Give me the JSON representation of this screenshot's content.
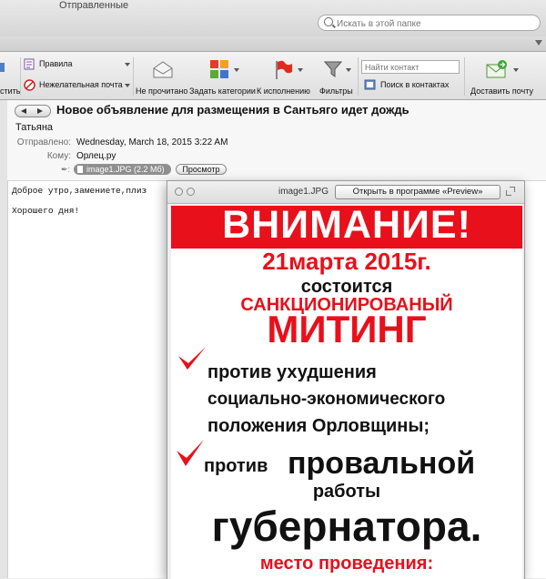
{
  "window": {
    "folder_title": "Отправленные",
    "search_placeholder": "Искать в этой папке"
  },
  "toolbar": {
    "clipped_label": "стить",
    "rules": "Правила",
    "junk": "Нежелательная почта",
    "unread": "Не прочитано",
    "categories": "Задать категории",
    "followup": "К исполнению",
    "filters": "Фильтры",
    "find_contact_placeholder": "Найти контакт",
    "search_contacts": "Поиск в контактах",
    "send_receive": "Доставить почту"
  },
  "message": {
    "subject": "Новое объявление для размещения в Сантьяго идет дождь",
    "sender": "Татьяна",
    "sent_label": "Отправлено:",
    "sent_value": "Wednesday, March 18, 2015 3:22 AM",
    "to_label": "Кому:",
    "to_value": "Орлец.ру",
    "attachment": "image1.JPG (2.2 Мб)",
    "preview_button": "Просмотр",
    "body_line1": "Доброе утро,замениете,плиз",
    "body_line2": "Хорошего дня!"
  },
  "quicklook": {
    "filename": "image1.JPG",
    "open_button": "Открыть в программе «Preview»"
  },
  "poster": {
    "banner": "ВНИМАНИЕ!",
    "date": "21марта 2015г.",
    "l1": "состоится",
    "l2": "САНКЦИОНИРОВАНЫЙ",
    "l3": "МИТИНГ",
    "l4": "против ухудшения",
    "l5": "социально-экономического",
    "l6": "положения Орловщины;",
    "l7a": "против",
    "l7b": "провальной",
    "l8": "работы",
    "l9": "губернатора.",
    "l10": "место проведения:"
  },
  "colors": {
    "poster_red": "#e8101b",
    "toolbar_bg": "#e6e6e6"
  }
}
